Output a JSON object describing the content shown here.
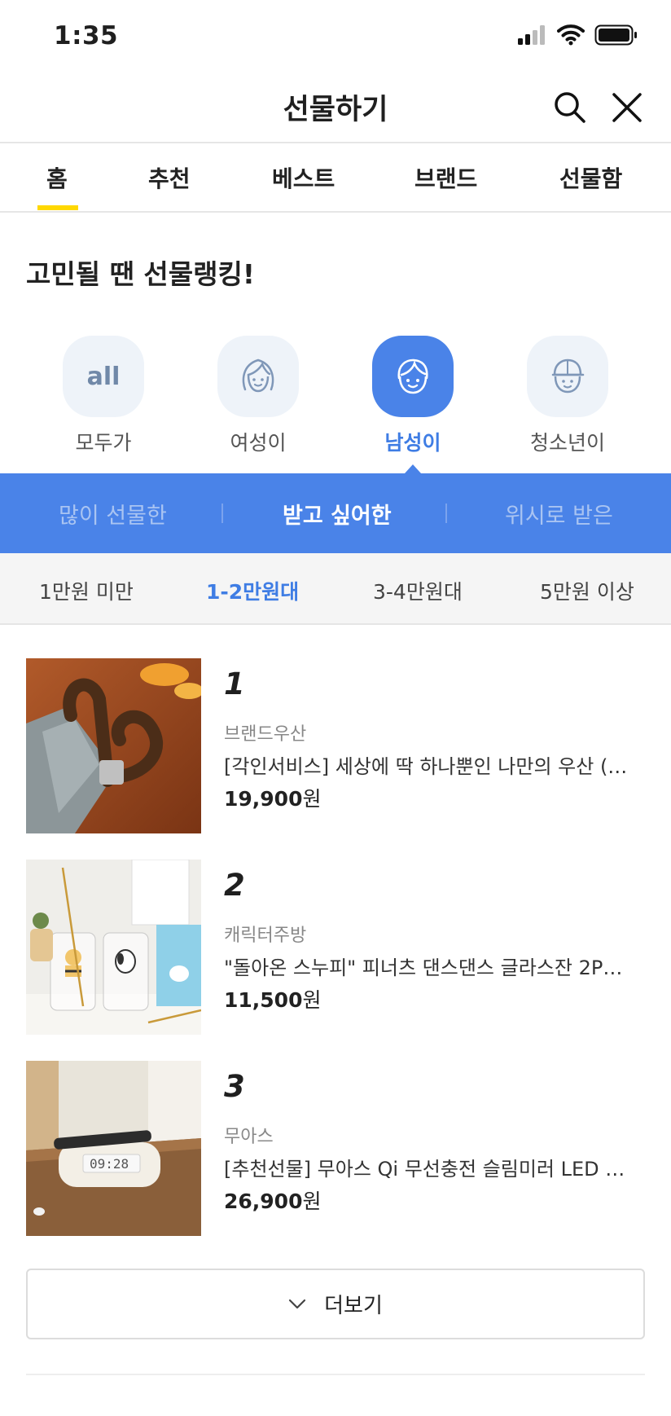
{
  "status_bar": {
    "time": "1:35"
  },
  "header": {
    "title": "선물하기"
  },
  "tabs": [
    "홈",
    "추천",
    "베스트",
    "브랜드",
    "선물함"
  ],
  "section": {
    "title": "고민될 땐 선물랭킹!"
  },
  "categories": [
    {
      "label": "모두가",
      "icon": "all-icon",
      "icon_text": "all",
      "active": false
    },
    {
      "label": "여성이",
      "icon": "woman-face-icon",
      "active": false
    },
    {
      "label": "남성이",
      "icon": "man-face-icon",
      "active": true
    },
    {
      "label": "청소년이",
      "icon": "teen-face-icon",
      "active": false
    }
  ],
  "subtabs": [
    "많이 선물한",
    "받고 싶어한",
    "위시로 받은"
  ],
  "price_filters": [
    "1만원 미만",
    "1-2만원대",
    "3-4만원대",
    "5만원 이상"
  ],
  "items": [
    {
      "rank": "1",
      "brand": "브랜드우산",
      "name": "[각인서비스] 세상에 딱 하나뿐인 나만의 우산 (…",
      "price": "19,900",
      "unit": "원"
    },
    {
      "rank": "2",
      "brand": "캐릭터주방",
      "name": "\"돌아온 스누피\" 피너츠 댄스댄스 글라스잔 2P…",
      "price": "11,500",
      "unit": "원"
    },
    {
      "rank": "3",
      "brand": "무아스",
      "name": "[추천선물] 무아스 Qi 무선충전 슬림미러 LED …",
      "price": "26,900",
      "unit": "원"
    }
  ],
  "clock_display": "09:28",
  "more_button": {
    "label": "더보기"
  },
  "colors": {
    "accent_blue": "#4a83e8",
    "tab_underline": "#ffd800"
  }
}
